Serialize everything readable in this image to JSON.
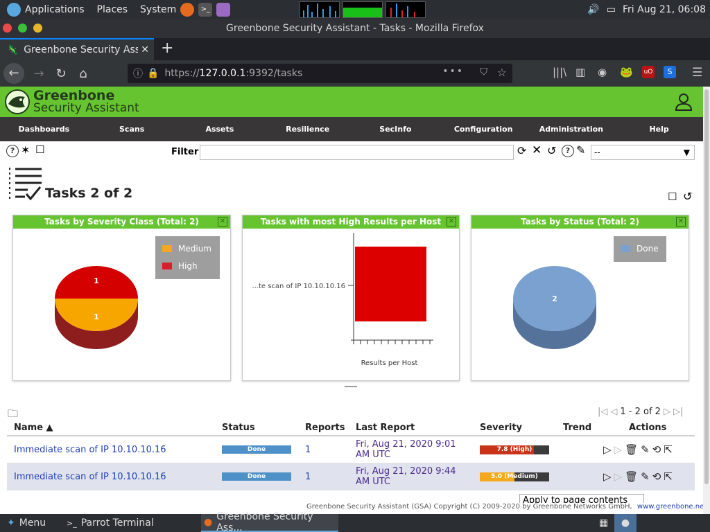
{
  "system": {
    "applications": "Applications",
    "places": "Places",
    "system": "System",
    "datetime": "Fri Aug 21, 06:08"
  },
  "window": {
    "title": "Greenbone Security Assistant - Tasks - Mozilla Firefox"
  },
  "browser": {
    "tab_title": "Greenbone Security Assi",
    "url_prefix": "https://",
    "url_host": "127.0.0.1",
    "url_rest": ":9392/tasks"
  },
  "gsa": {
    "brand_line1": "Greenbone",
    "brand_line2": "Security Assistant",
    "menu": [
      "Dashboards",
      "Scans",
      "Assets",
      "Resilience",
      "SecInfo",
      "Configuration",
      "Administration",
      "Help"
    ],
    "filter_label": "Filter",
    "filter_value": "",
    "filter_select": "--",
    "page_title": "Tasks 2 of 2"
  },
  "panels": {
    "severity": {
      "title": "Tasks by Severity Class (Total: 2)",
      "legend": [
        {
          "label": "Medium",
          "color": "#f5a81b"
        },
        {
          "label": "High",
          "color": "#d8202c"
        }
      ]
    },
    "high_results": {
      "title": "Tasks with most High Results per Host",
      "ylabel_item": "...te scan of IP 10.10.10.16",
      "xlabel": "Results per Host"
    },
    "status": {
      "title": "Tasks by Status (Total: 2)",
      "legend": [
        {
          "label": "Done",
          "color": "#7aa1d0"
        }
      ]
    }
  },
  "chart_data": [
    {
      "type": "pie",
      "title": "Tasks by Severity Class (Total: 2)",
      "categories": [
        "High",
        "Medium"
      ],
      "values": [
        1,
        1
      ],
      "legend": "top-right"
    },
    {
      "type": "bar",
      "title": "Tasks with most High Results per Host",
      "categories": [
        "...te scan of IP 10.10.10.16"
      ],
      "values": [
        1
      ],
      "xlabel": "Results per Host",
      "orientation": "horizontal"
    },
    {
      "type": "pie",
      "title": "Tasks by Status (Total: 2)",
      "categories": [
        "Done"
      ],
      "values": [
        2
      ],
      "legend": "top-right"
    }
  ],
  "pagination": {
    "text": "1 - 2 of 2"
  },
  "table": {
    "columns": [
      "Name",
      "Status",
      "Reports",
      "Last Report",
      "Severity",
      "Trend",
      "Actions"
    ],
    "sort_arrow": "▲",
    "rows": [
      {
        "name": "Immediate scan of IP 10.10.10.16",
        "status": "Done",
        "reports": "1",
        "last1": "Fri, Aug 21, 2020 9:01",
        "last2": "AM UTC",
        "severity": "7.8 (High)",
        "sev_value": 7.8,
        "sev_color": "#c8341a"
      },
      {
        "name": "Immediate scan of IP 10.10.10.16",
        "status": "Done",
        "reports": "1",
        "last1": "Fri, Aug 21, 2020 9:44",
        "last2": "AM UTC",
        "severity": "5.0 (Medium)",
        "sev_value": 5.0,
        "sev_color": "#f5a81b"
      }
    ],
    "apply_label": "Apply to page contents",
    "footer": "Greenbone Security Assistant (GSA) Copyright (C) 2009-2020 by Greenbone Networks GmbH,",
    "footer_link": "www.greenbone.net"
  },
  "taskbar": {
    "menu": "Menu",
    "items": [
      "Parrot Terminal",
      "Greenbone Security Ass..."
    ]
  }
}
